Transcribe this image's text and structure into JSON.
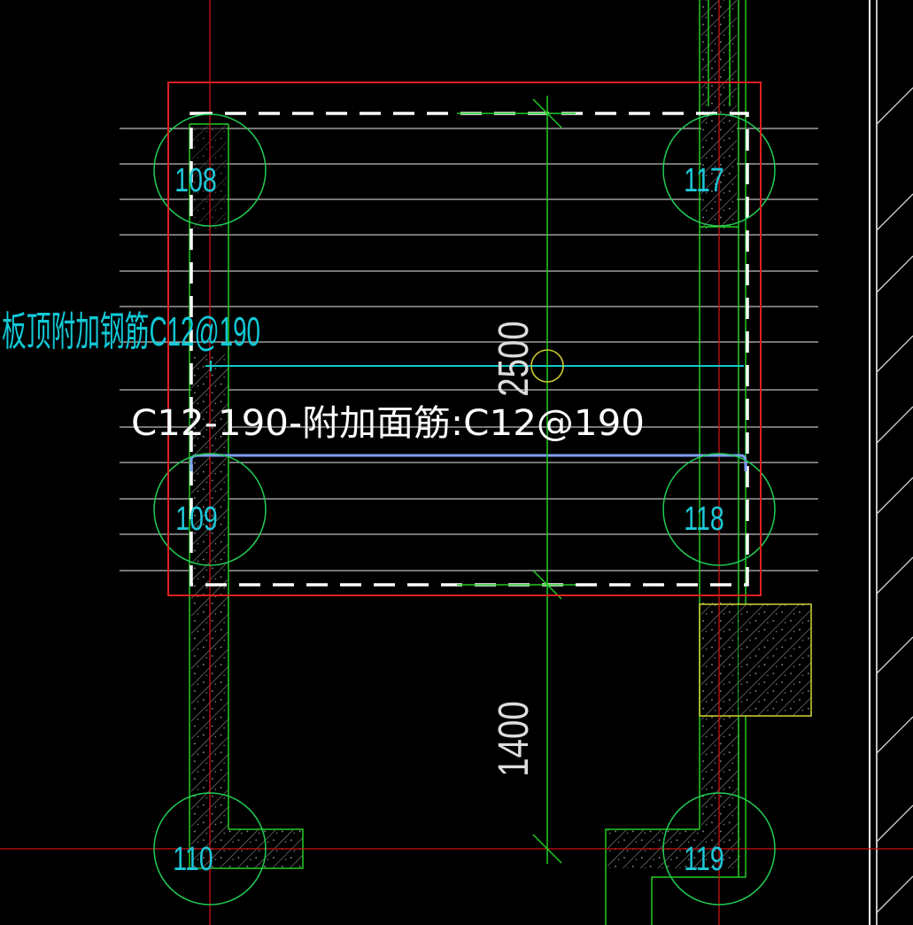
{
  "drawing": {
    "background_color": "#000000",
    "annotation_label": "板顶附加钢筋C12@190",
    "tooltip_text": "C12-190-附加面筋:C12@190",
    "dimensions": {
      "upper": "2500",
      "lower": "1400"
    },
    "pile_labels": {
      "top_left": "108",
      "top_right": "117",
      "mid_left": "109",
      "mid_right": "118",
      "bottom_left": "110",
      "bottom_right": "119"
    }
  },
  "colors": {
    "selection_box": "#e02020",
    "axis_line": "#cc1111",
    "pile_circle": "#22cc55",
    "pile_label": "#1ec8d8",
    "wall_outline": "#22cc22",
    "wall_hatch": "#8a8a8a",
    "dashed_region": "#ffffff",
    "rebar_lines": "#bdbdbd",
    "cyan_rebar": "#11c8c8",
    "blue_rebar": "#7f9fff",
    "dimension_line": "#22cc22",
    "dimension_text": "#dddddd",
    "annotation_text": "#11c8d6",
    "yellow_element": "#c8c830",
    "tooltip_text": "#ffffff"
  }
}
